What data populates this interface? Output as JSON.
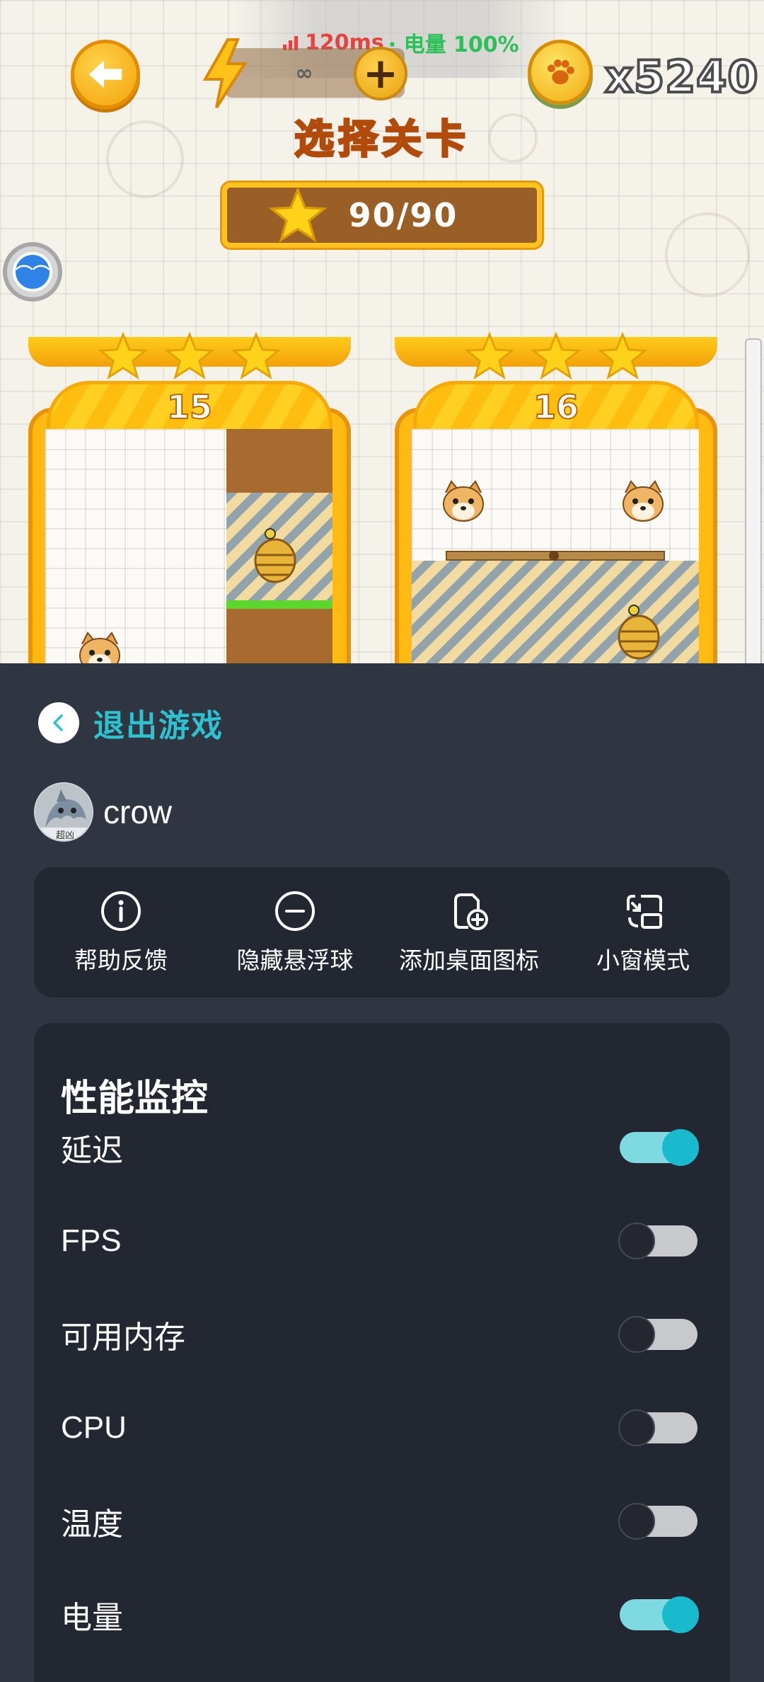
{
  "status": {
    "latency": "120ms",
    "battery": "· 电量 100%"
  },
  "game": {
    "energy_value": "∞",
    "coins": "x5240",
    "title": "选择关卡",
    "star_total": "90/90",
    "float_ball_label": "⌒⌒",
    "levels": [
      {
        "number": "15",
        "stars": 3
      },
      {
        "number": "16",
        "stars": 3
      }
    ]
  },
  "panel": {
    "exit_label": "退出游戏",
    "username": "crow",
    "avatar_text": "超凶",
    "quick_actions": [
      {
        "label": "帮助反馈",
        "icon": "info-icon"
      },
      {
        "label": "隐藏悬浮球",
        "icon": "minus-circle-icon"
      },
      {
        "label": "添加桌面图标",
        "icon": "add-shortcut-icon"
      },
      {
        "label": "小窗模式",
        "icon": "small-window-icon"
      }
    ],
    "perf_title": "性能监控",
    "perf_items": [
      {
        "label": "延迟",
        "enabled": true
      },
      {
        "label": "FPS",
        "enabled": false
      },
      {
        "label": "可用内存",
        "enabled": false
      },
      {
        "label": "CPU",
        "enabled": false
      },
      {
        "label": "温度",
        "enabled": false
      },
      {
        "label": "电量",
        "enabled": true
      }
    ],
    "accent_color": "#2ec2d0",
    "toggle_on_color": "#19bacd"
  }
}
